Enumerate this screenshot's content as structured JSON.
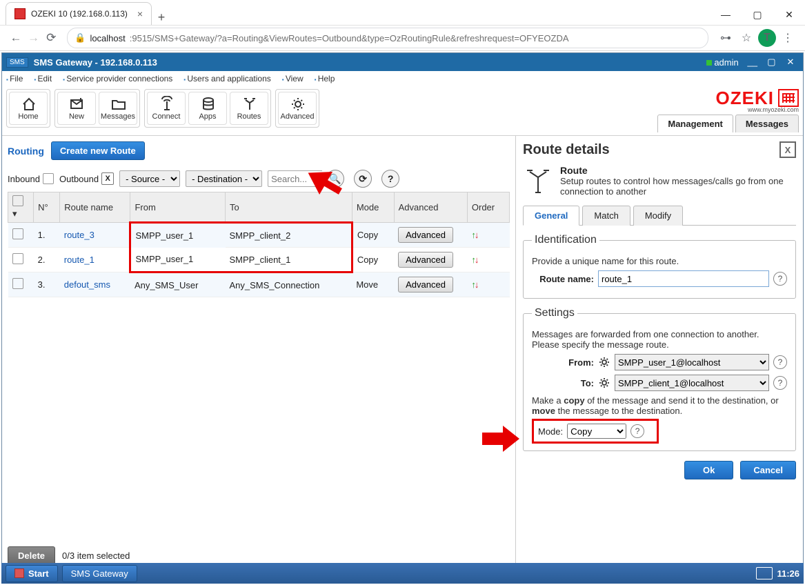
{
  "browser": {
    "tab_title": "OZEKI 10 (192.168.0.113)",
    "url_host": "localhost",
    "url_path": ":9515/SMS+Gateway/?a=Routing&ViewRoutes=Outbound&type=OzRoutingRule&refreshrequest=OFYEOZDA",
    "avatar_letter": "T"
  },
  "app": {
    "title": "SMS Gateway  -  192.168.0.113",
    "user": "admin",
    "menus": [
      "File",
      "Edit",
      "Service provider connections",
      "Users and applications",
      "View",
      "Help"
    ],
    "toolbar": [
      {
        "id": "home",
        "label": "Home"
      },
      {
        "id": "new",
        "label": "New"
      },
      {
        "id": "messages",
        "label": "Messages"
      },
      {
        "id": "connect",
        "label": "Connect"
      },
      {
        "id": "apps",
        "label": "Apps"
      },
      {
        "id": "routes",
        "label": "Routes"
      },
      {
        "id": "advanced",
        "label": "Advanced"
      }
    ],
    "logo_text": "OZEKI",
    "logo_sub": "www.myozeki.com",
    "header_tabs": [
      "Management",
      "Messages"
    ],
    "header_tab_active": 0
  },
  "routing": {
    "title": "Routing",
    "create_btn": "Create new Route",
    "filter_inbound": "Inbound",
    "filter_outbound": "Outbound",
    "source_sel": "- Source -",
    "dest_sel": "- Destination -",
    "search_placeholder": "Search...",
    "columns": [
      "",
      "N°",
      "Route name",
      "From",
      "To",
      "Mode",
      "Advanced",
      "Order"
    ],
    "rows": [
      {
        "n": "1.",
        "name": "route_3",
        "from": "SMPP_user_1",
        "to": "SMPP_client_2",
        "mode": "Copy",
        "adv": "Advanced"
      },
      {
        "n": "2.",
        "name": "route_1",
        "from": "SMPP_user_1",
        "to": "SMPP_client_1",
        "mode": "Copy",
        "adv": "Advanced"
      },
      {
        "n": "3.",
        "name": "defout_sms",
        "from": "Any_SMS_User",
        "to": "Any_SMS_Connection",
        "mode": "Move",
        "adv": "Advanced"
      }
    ],
    "delete_btn": "Delete",
    "selection_text": "0/3 item selected"
  },
  "details": {
    "panel_title": "Route details",
    "sub_title": "Route",
    "sub_desc": "Setup routes to control how messages/calls go from one connection to another",
    "tabs": [
      "General",
      "Match",
      "Modify"
    ],
    "tab_active": 0,
    "ident_legend": "Identification",
    "ident_note": "Provide a unique name for this route.",
    "route_name_label": "Route name:",
    "route_name_value": "route_1",
    "settings_legend": "Settings",
    "settings_note": "Messages are forwarded from one connection to another. Please specify the message route.",
    "from_label": "From:",
    "from_value": "SMPP_user_1@localhost",
    "to_label": "To:",
    "to_value": "SMPP_client_1@localhost",
    "mode_note_a": "Make a ",
    "mode_note_b": "copy",
    "mode_note_c": " of the message and send it to the destination, or ",
    "mode_note_d": "move",
    "mode_note_e": " the message to the destination.",
    "mode_label": "Mode:",
    "mode_value": "Copy",
    "ok_btn": "Ok",
    "cancel_btn": "Cancel"
  },
  "taskbar": {
    "start": "Start",
    "app": "SMS Gateway",
    "clock": "11:26"
  }
}
